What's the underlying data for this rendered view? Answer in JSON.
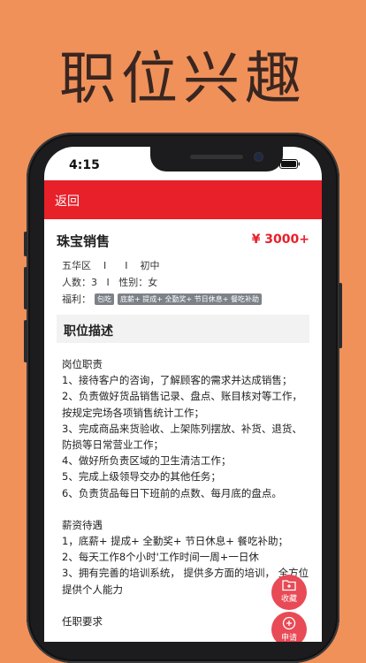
{
  "headline": "职位兴趣",
  "status_bar": {
    "time": "4:15"
  },
  "navbar": {
    "back_label": "返回"
  },
  "job": {
    "title": "珠宝销售",
    "salary": "¥ 3000+",
    "location_line": "五华区    I      I    初中",
    "people_gender_line": "人数：3   I   性别：女",
    "benefits_label": "福利：",
    "benefit_tags": [
      "包吃",
      "底薪+ 提成+ 全勤奖+ 节日休息+ 餐吃补助"
    ]
  },
  "section": {
    "title": "职位描述"
  },
  "description": {
    "duties_heading": "岗位职责",
    "duties": [
      "1、接待客户的咨询，了解顾客的需求并达成销售；",
      "2、负责做好货品销售记录、盘点、账目核对等工作，按规定完场各项销售统计工作；",
      "3、完成商品来货验收、上架陈列摆放、补货、退货、防损等日常营业工作；",
      "4、做好所负责区域的卫生清洁工作；",
      "5、完成上级领导交办的其他任务；",
      "6、负责货品每日下班前的点数、每月底的盘点。"
    ],
    "salary_heading": "薪资待遇",
    "salary_items": [
      "1，底薪+ 提成+ 全勤奖+ 节日休息+ 餐吃补助；",
      "2、每天工作8个小时'工作时间一周+一日休",
      "3、拥有完善的培训系统， 提供多方面的培训， 全方位提供个人能力"
    ],
    "requirements_heading": "任职要求"
  },
  "actions": {
    "favorite_label": "收藏",
    "apply_label": "申请"
  },
  "colors": {
    "background": "#F0915A",
    "accent": "#E8202A",
    "fab": "#E84A56"
  }
}
